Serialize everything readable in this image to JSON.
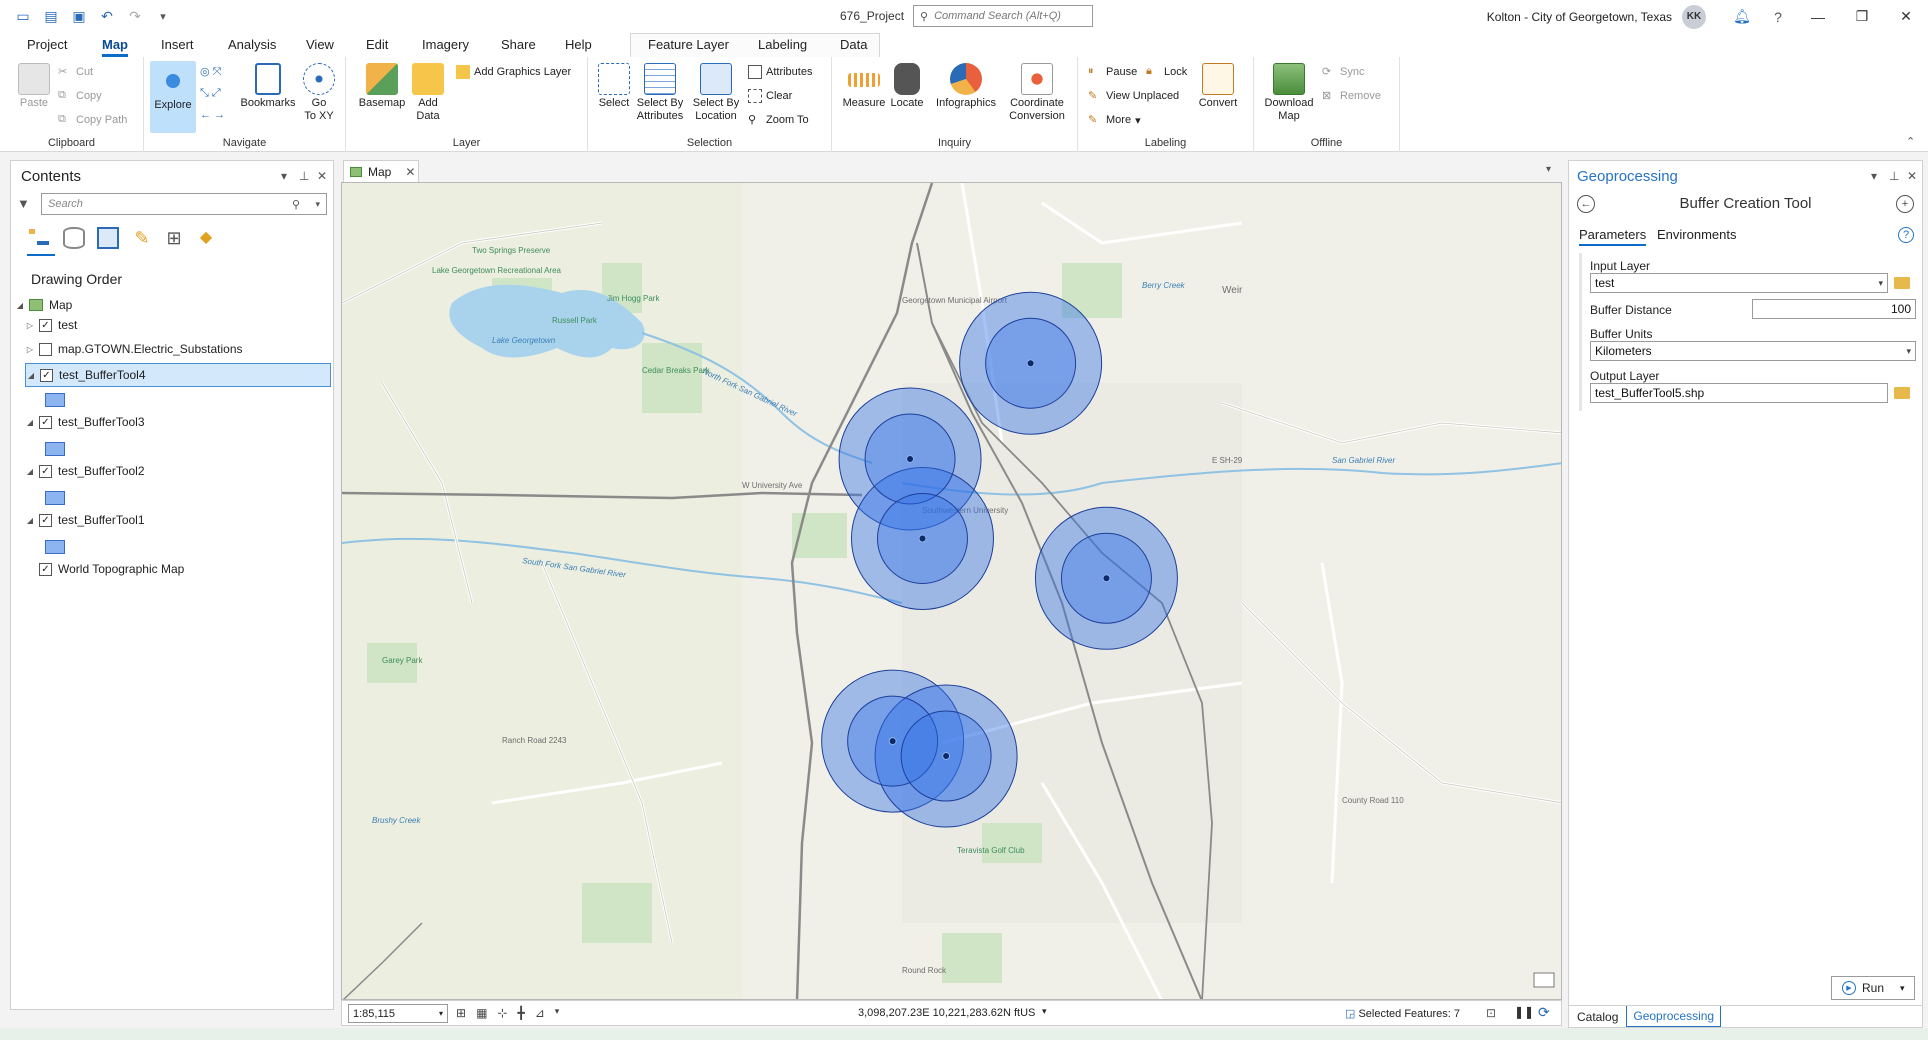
{
  "titlebar": {
    "project_name": "676_Project",
    "command_search_placeholder": "Command Search (Alt+Q)",
    "user_name": "Kolton - City of Georgetown, Texas",
    "user_initials": "KK"
  },
  "ribbon_tabs": [
    "Project",
    "Map",
    "Insert",
    "Analysis",
    "View",
    "Edit",
    "Imagery",
    "Share",
    "Help",
    "Feature Layer",
    "Labeling",
    "Data"
  ],
  "active_tab": "Map",
  "ribbon": {
    "clipboard": {
      "label": "Clipboard",
      "paste": "Paste",
      "cut": "Cut",
      "copy": "Copy",
      "copy_path": "Copy Path"
    },
    "navigate": {
      "label": "Navigate",
      "explore": "Explore",
      "bookmarks": "Bookmarks",
      "go_to_xy_1": "Go",
      "go_to_xy_2": "To XY"
    },
    "layer": {
      "label": "Layer",
      "basemap": "Basemap",
      "add_data_1": "Add",
      "add_data_2": "Data",
      "add_graphics_layer": "Add Graphics Layer"
    },
    "selection": {
      "label": "Selection",
      "select": "Select",
      "select_by_attributes_1": "Select By",
      "select_by_attributes_2": "Attributes",
      "select_by_location_1": "Select By",
      "select_by_location_2": "Location",
      "attributes": "Attributes",
      "clear": "Clear",
      "zoom_to": "Zoom To"
    },
    "inquiry": {
      "label": "Inquiry",
      "measure": "Measure",
      "locate": "Locate",
      "infographics": "Infographics",
      "coordinate_conversion_1": "Coordinate",
      "coordinate_conversion_2": "Conversion"
    },
    "labeling": {
      "label": "Labeling",
      "pause": "Pause",
      "lock": "Lock",
      "view_unplaced": "View Unplaced",
      "more": "More",
      "convert": "Convert"
    },
    "offline": {
      "label": "Offline",
      "download_map_1": "Download",
      "download_map_2": "Map",
      "sync": "Sync",
      "remove": "Remove"
    }
  },
  "contents": {
    "title": "Contents",
    "search_placeholder": "Search",
    "drawing_order": "Drawing Order",
    "map_label": "Map",
    "layers": [
      {
        "name": "test",
        "checked": true
      },
      {
        "name": "map.GTOWN.Electric_Substations",
        "checked": false
      },
      {
        "name": "test_BufferTool4",
        "checked": true
      },
      {
        "name": "test_BufferTool3",
        "checked": true
      },
      {
        "name": "test_BufferTool2",
        "checked": true
      },
      {
        "name": "test_BufferTool1",
        "checked": true
      },
      {
        "name": "World Topographic Map",
        "checked": true
      }
    ]
  },
  "map": {
    "tab_label": "Map",
    "buffer_fill": "#2f6fe8",
    "buffer_stroke": "#1d3f9a",
    "labels": {
      "lake": "Lake Georgetown",
      "lake_rec": "Lake Georgetown Recreational Area",
      "north_fork": "North Fork San Gabriel River",
      "south_fork": "South Fork San Gabriel River",
      "san_gabriel": "San Gabriel River",
      "university": "W University Ave",
      "airport": "Georgetown Municipal Airport",
      "southwestern": "Southwestern University",
      "weir": "Weir",
      "garey_park": "Garey Park",
      "brushy": "Brushy Creek",
      "ranch_road": "Ranch Road 2243",
      "county_road": "County Road 110",
      "esh29": "E SH-29",
      "jim_hogg": "Jim Hogg Park",
      "russell_park": "Russell Park",
      "cedar_breaks": "Cedar Breaks Park",
      "two_springs": "Two Springs Preserve",
      "berry_creek": "Berry Creek",
      "teravista": "Teravista Golf Club",
      "round_rock": "Round Rock"
    }
  },
  "statusbar": {
    "scale": "1:85,115",
    "coordinates": "3,098,207.23E 10,221,283.62N ftUS",
    "selected_features": "Selected Features: 7"
  },
  "geoprocessing": {
    "title": "Geoprocessing",
    "tool_title": "Buffer Creation Tool",
    "tab_parameters": "Parameters",
    "tab_environments": "Environments",
    "input_layer_label": "Input Layer",
    "input_layer_value": "test",
    "buffer_distance_label": "Buffer Distance",
    "buffer_distance_value": "100",
    "buffer_units_label": "Buffer Units",
    "buffer_units_value": "Kilometers",
    "output_layer_label": "Output Layer",
    "output_layer_value": "test_BufferTool5.shp",
    "run_label": "Run",
    "bottom_tab_catalog": "Catalog",
    "bottom_tab_geoprocessing": "Geoprocessing"
  }
}
